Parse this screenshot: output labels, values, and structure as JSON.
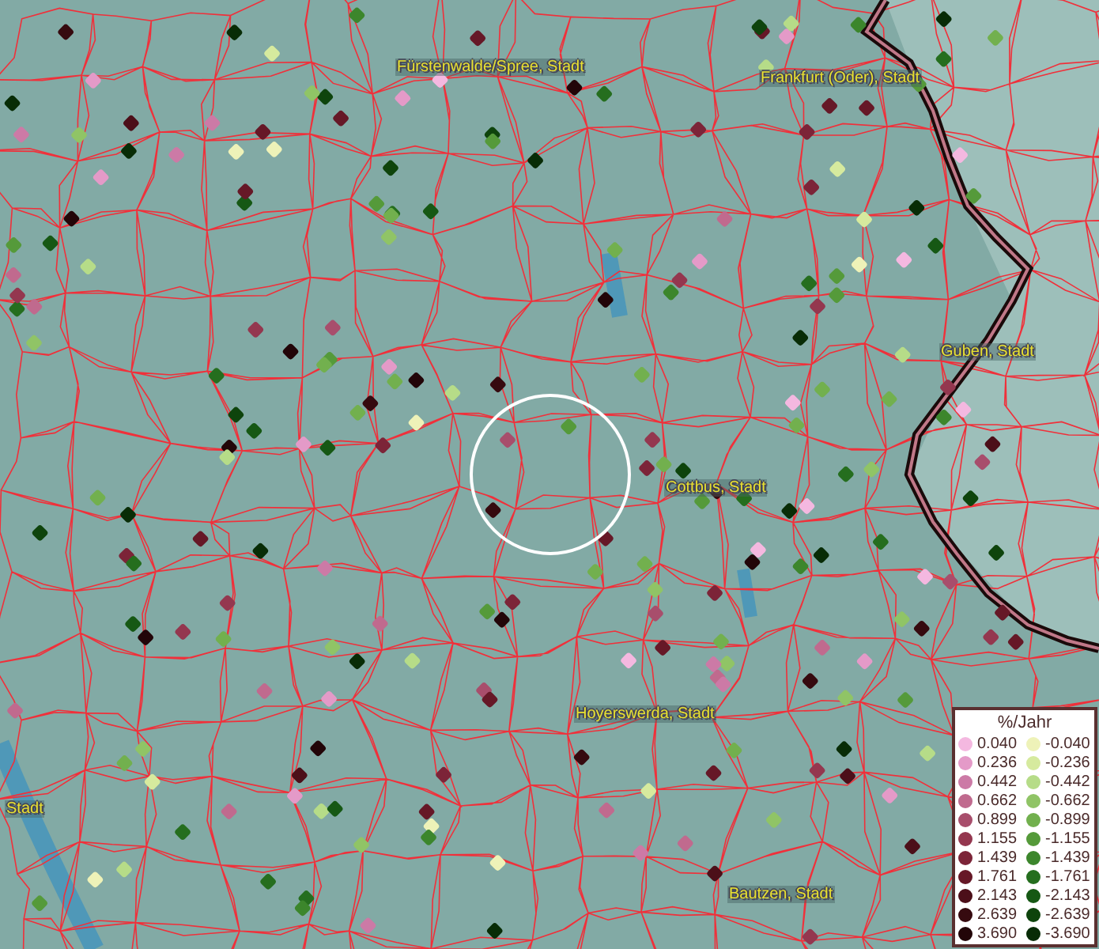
{
  "map": {
    "places": [
      {
        "name": "Fürstenwalde/Spree, Stadt"
      },
      {
        "name": "Frankfurt (Oder), Stadt"
      },
      {
        "name": "Guben, Stadt"
      },
      {
        "name": "Cottbus, Stadt"
      },
      {
        "name": "Hoyerswerda, Stadt"
      },
      {
        "name": "Stadt"
      },
      {
        "name": "Bautzen, Stadt"
      }
    ]
  },
  "legend": {
    "title": "%/Jahr",
    "entries": [
      {
        "label": "0.040",
        "color": "#f4b8e0"
      },
      {
        "label": "-0.040",
        "color": "#eef2b8"
      },
      {
        "label": "0.236",
        "color": "#e49ac8"
      },
      {
        "label": "-0.236",
        "color": "#d6ea9e"
      },
      {
        "label": "0.442",
        "color": "#cc7aa6"
      },
      {
        "label": "-0.442",
        "color": "#b6dc88"
      },
      {
        "label": "0.662",
        "color": "#c06a8e"
      },
      {
        "label": "-0.662",
        "color": "#90c466"
      },
      {
        "label": "0.899",
        "color": "#a84e6c"
      },
      {
        "label": "-0.899",
        "color": "#72b04e"
      },
      {
        "label": "1.155",
        "color": "#94374f"
      },
      {
        "label": "-1.155",
        "color": "#559a3a"
      },
      {
        "label": "1.439",
        "color": "#7c2438"
      },
      {
        "label": "-1.439",
        "color": "#3c862c"
      },
      {
        "label": "1.761",
        "color": "#661827"
      },
      {
        "label": "-1.761",
        "color": "#256e1e"
      },
      {
        "label": "2.143",
        "color": "#4c0f19"
      },
      {
        "label": "-2.143",
        "color": "#165814"
      },
      {
        "label": "2.639",
        "color": "#360a0f"
      },
      {
        "label": "-2.639",
        "color": "#0e440c"
      },
      {
        "label": "3.690",
        "color": "#220508"
      },
      {
        "label": "-3.690",
        "color": "#082c06"
      }
    ]
  }
}
